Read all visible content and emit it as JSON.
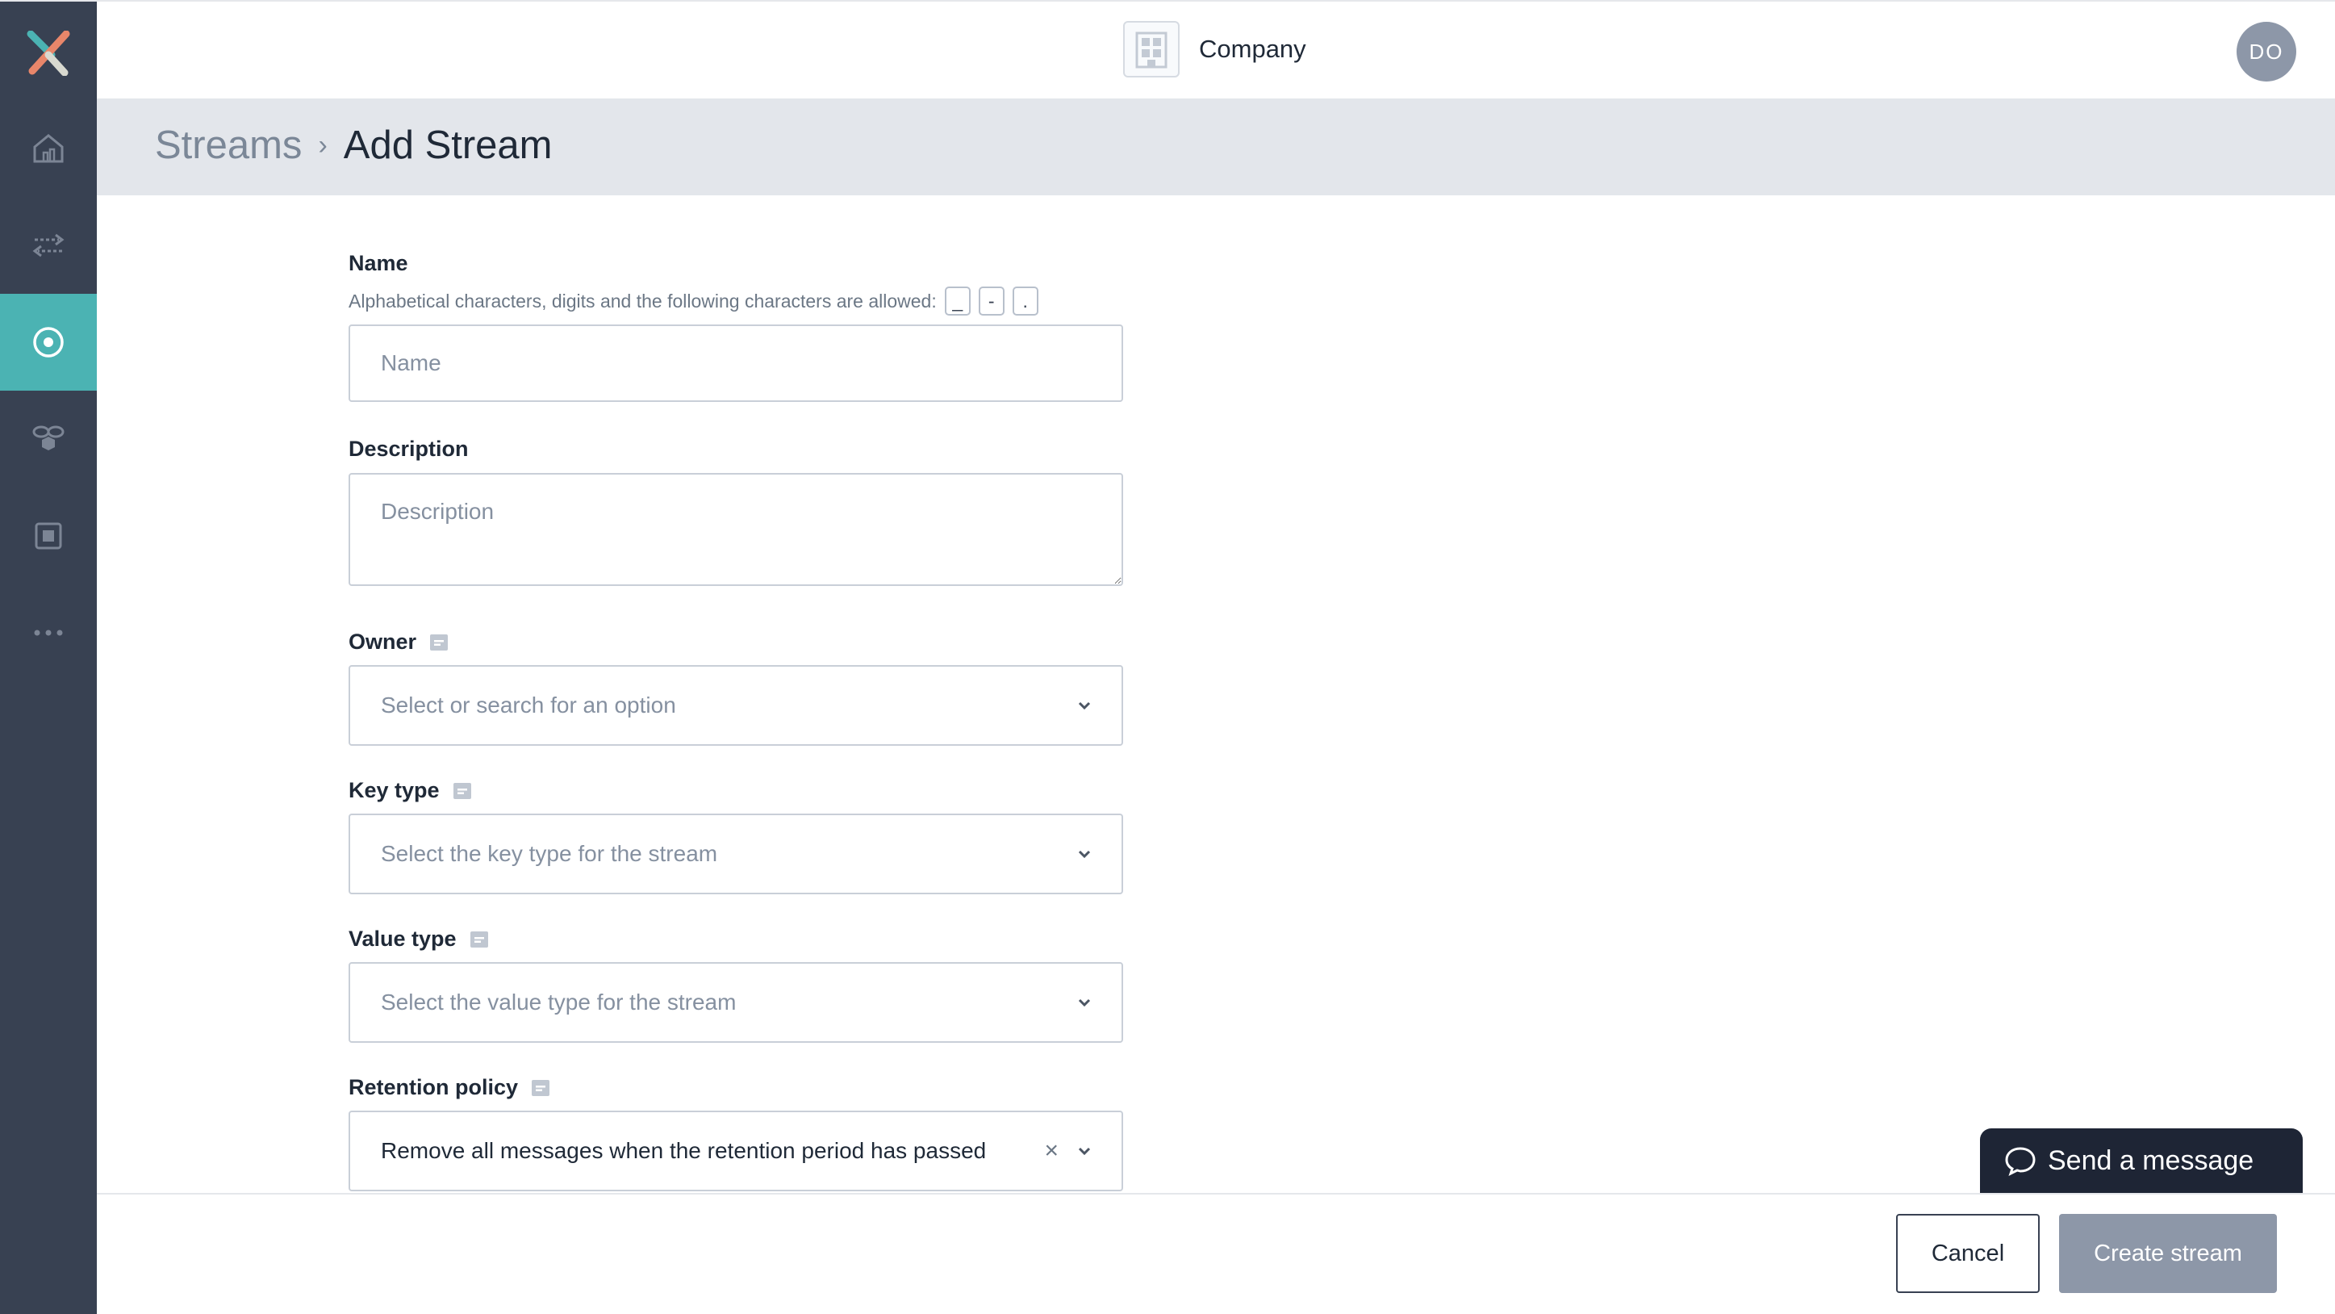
{
  "header": {
    "company": "Company",
    "avatar_initials": "DO"
  },
  "breadcrumb": {
    "parent": "Streams",
    "separator": "›",
    "current": "Add Stream"
  },
  "form": {
    "name": {
      "label": "Name",
      "help": "Alphabetical characters, digits and the following characters are allowed:",
      "allowed_chars": [
        "_",
        "-",
        "."
      ],
      "placeholder": "Name",
      "value": ""
    },
    "description": {
      "label": "Description",
      "placeholder": "Description",
      "value": ""
    },
    "owner": {
      "label": "Owner",
      "placeholder": "Select or search for an option"
    },
    "key_type": {
      "label": "Key type",
      "placeholder": "Select the key type for the stream"
    },
    "value_type": {
      "label": "Value type",
      "placeholder": "Select the value type for the stream"
    },
    "retention_policy": {
      "label": "Retention policy",
      "value": "Remove all messages when the retention period has passed",
      "clear_glyph": "×"
    }
  },
  "footer": {
    "cancel_label": "Cancel",
    "create_label": "Create stream"
  },
  "chat": {
    "label": "Send a message"
  },
  "sidebar": {
    "items": [
      {
        "id": "home",
        "icon": "home-icon"
      },
      {
        "id": "pipelines",
        "icon": "arrows-icon"
      },
      {
        "id": "streams",
        "icon": "target-icon",
        "active": true
      },
      {
        "id": "connectors",
        "icon": "bees-icon"
      },
      {
        "id": "apps",
        "icon": "chip-icon"
      },
      {
        "id": "more",
        "icon": "more-icon"
      }
    ]
  },
  "colors": {
    "sidebar": "#384152",
    "active": "#4bb3b3",
    "crumb_bg": "#e3e6eb",
    "primary_disabled": "#8d97a8"
  }
}
